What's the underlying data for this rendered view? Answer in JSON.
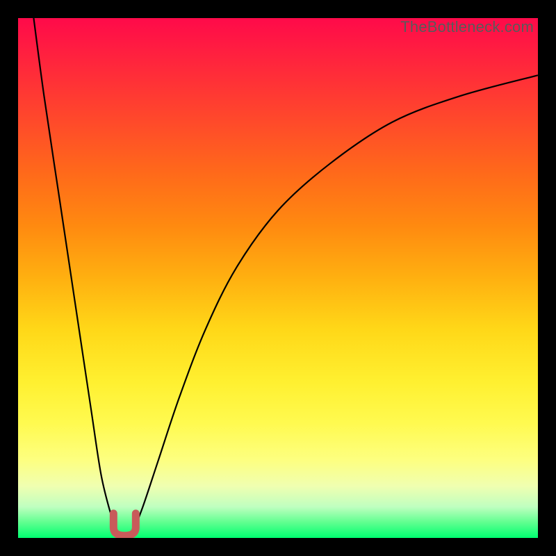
{
  "attribution": "TheBottleneck.com",
  "colors": {
    "frame": "#000000",
    "curve": "#000000",
    "marker": "#c85a5a",
    "gradient_top": "#ff0a4a",
    "gradient_bottom": "#00ff70"
  },
  "chart_data": {
    "type": "line",
    "title": "",
    "xlabel": "",
    "ylabel": "",
    "xlim": [
      0,
      100
    ],
    "ylim": [
      0,
      100
    ],
    "series": [
      {
        "name": "left-branch",
        "x": [
          3,
          5,
          8,
          11,
          14,
          16,
          18,
          19,
          19.5
        ],
        "values": [
          100,
          85,
          65,
          45,
          25,
          12,
          4,
          1,
          0
        ]
      },
      {
        "name": "right-branch",
        "x": [
          21.5,
          22,
          24,
          27,
          31,
          36,
          42,
          50,
          60,
          72,
          85,
          100
        ],
        "values": [
          0,
          1,
          6,
          15,
          27,
          40,
          52,
          63,
          72,
          80,
          85,
          89
        ]
      }
    ],
    "marker": {
      "shape": "U",
      "x_center": 20.5,
      "y_center": 1.5,
      "color": "#c85a5a"
    },
    "background": {
      "type": "vertical-gradient",
      "meaning": "red-top to green-bottom heat scale"
    }
  }
}
